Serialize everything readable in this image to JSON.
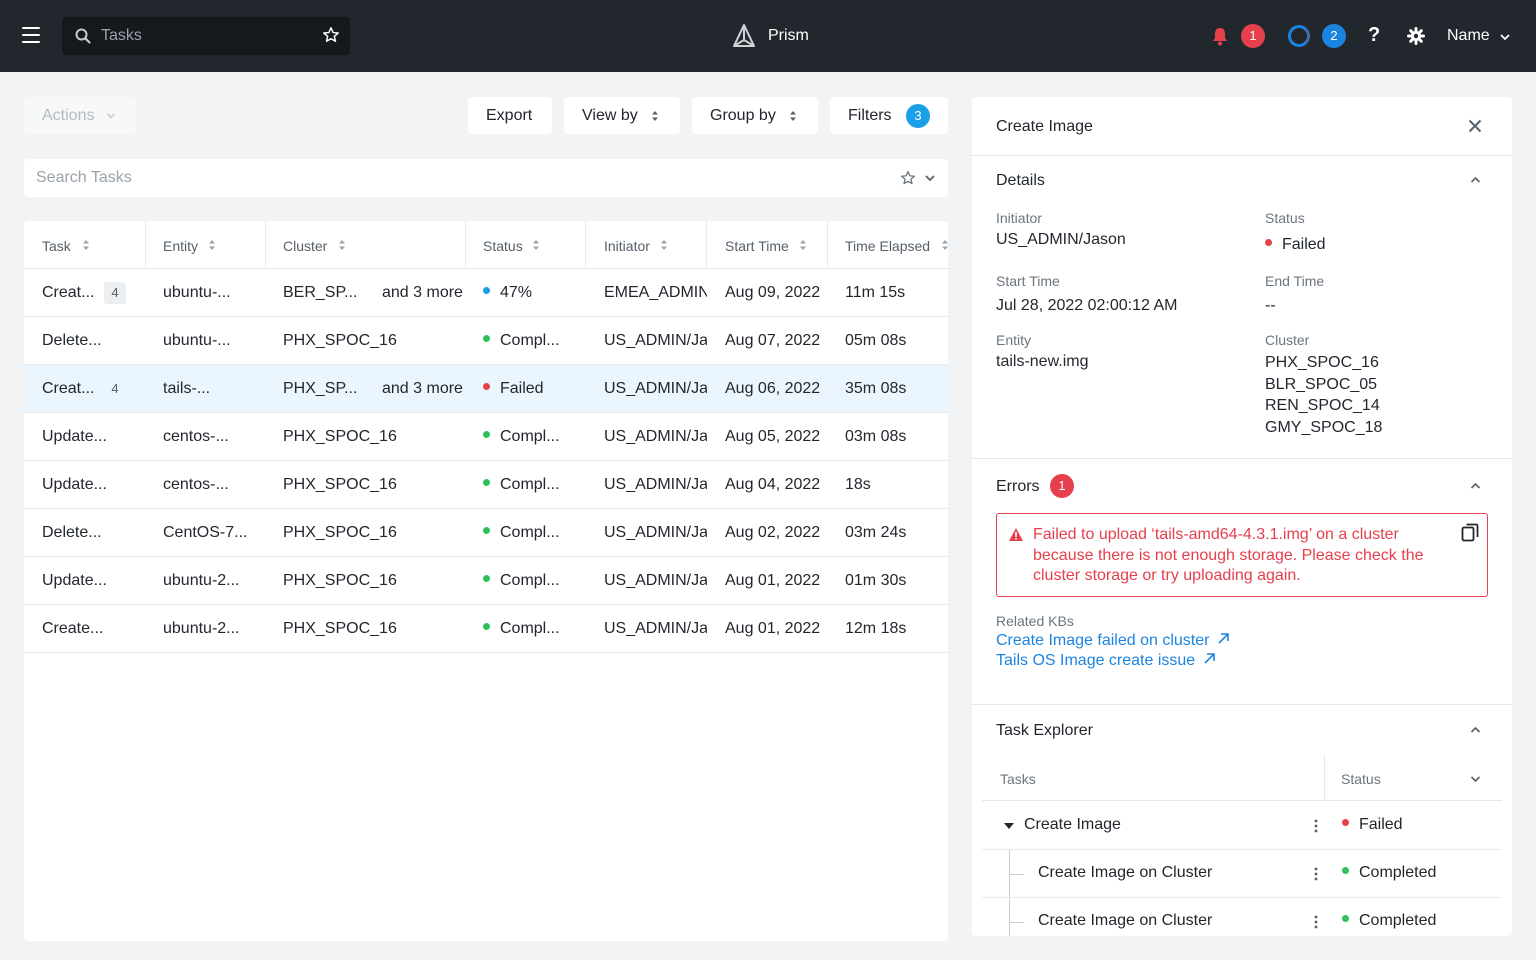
{
  "topbar": {
    "search_placeholder": "Tasks",
    "brand": "Prism",
    "alerts_count": "1",
    "tasks_count": "2",
    "help": "?",
    "user_name": "Name"
  },
  "toolbar": {
    "actions": "Actions",
    "export": "Export",
    "view_by": "View by",
    "group_by": "Group by",
    "filters": "Filters",
    "filters_count": "3",
    "search_placeholder": "Search Tasks"
  },
  "table": {
    "columns": [
      "Task",
      "Entity",
      "Cluster",
      "Status",
      "Initiator",
      "Start Time",
      "Time Elapsed"
    ],
    "rows": [
      {
        "task": "Creat...",
        "count": "4",
        "entity": "ubuntu-...",
        "cluster": "BER_SP...",
        "more": "and 3 more",
        "status": "47%",
        "status_type": "running",
        "initiator": "EMEA_ADMIN",
        "start": "Aug 09, 2022",
        "elapsed": "11m 15s"
      },
      {
        "task": "Delete...",
        "count": "",
        "entity": "ubuntu-...",
        "cluster": "PHX_SPOC_16",
        "more": "",
        "status": "Compl...",
        "status_type": "ok",
        "initiator": "US_ADMIN/Ja",
        "start": "Aug 07, 2022",
        "elapsed": "05m 08s"
      },
      {
        "task": "Creat...",
        "count": "4",
        "entity": "tails-...",
        "cluster": "PHX_SP...",
        "more": "and 3 more",
        "status": "Failed",
        "status_type": "failed",
        "initiator": "US_ADMIN/Ja",
        "start": "Aug 06, 2022",
        "elapsed": "35m 08s"
      },
      {
        "task": "Update...",
        "count": "",
        "entity": "centos-...",
        "cluster": "PHX_SPOC_16",
        "more": "",
        "status": "Compl...",
        "status_type": "ok",
        "initiator": "US_ADMIN/Ja",
        "start": "Aug 05, 2022",
        "elapsed": "03m 08s"
      },
      {
        "task": "Update...",
        "count": "",
        "entity": "centos-...",
        "cluster": "PHX_SPOC_16",
        "more": "",
        "status": "Compl...",
        "status_type": "ok",
        "initiator": "US_ADMIN/Ja",
        "start": "Aug 04, 2022",
        "elapsed": "18s"
      },
      {
        "task": "Delete...",
        "count": "",
        "entity": "CentOS-7...",
        "cluster": "PHX_SPOC_16",
        "more": "",
        "status": "Compl...",
        "status_type": "ok",
        "initiator": "US_ADMIN/Ja",
        "start": "Aug 02, 2022",
        "elapsed": "03m 24s"
      },
      {
        "task": "Update...",
        "count": "",
        "entity": "ubuntu-2...",
        "cluster": "PHX_SPOC_16",
        "more": "",
        "status": "Compl...",
        "status_type": "ok",
        "initiator": "US_ADMIN/Ja",
        "start": "Aug 01, 2022",
        "elapsed": "01m 30s"
      },
      {
        "task": "Create...",
        "count": "",
        "entity": "ubuntu-2...",
        "cluster": "PHX_SPOC_16",
        "more": "",
        "status": "Compl...",
        "status_type": "ok",
        "initiator": "US_ADMIN/Ja",
        "start": "Aug 01, 2022",
        "elapsed": "12m 18s"
      }
    ]
  },
  "panel": {
    "title": "Create Image",
    "details": {
      "title": "Details",
      "initiator_label": "Initiator",
      "initiator": "US_ADMIN/Jason",
      "status_label": "Status",
      "status": "Failed",
      "start_label": "Start Time",
      "start": "Jul 28, 2022 02:00:12 AM",
      "end_label": "End Time",
      "end": "--",
      "entity_label": "Entity",
      "entity": "tails-new.img",
      "cluster_label": "Cluster",
      "clusters": [
        "PHX_SPOC_16",
        "BLR_SPOC_05",
        "REN_SPOC_14",
        "GMY_SPOC_18"
      ]
    },
    "errors": {
      "title": "Errors",
      "count": "1",
      "message": "Failed to upload ‘tails-amd64-4.3.1.img’ on a cluster because there is not enough storage. Please check the cluster storage or try uploading again.",
      "kb_label": "Related KBs",
      "kbs": [
        "Create Image failed on cluster",
        "Tails OS Image create issue"
      ]
    },
    "explorer": {
      "title": "Task Explorer",
      "col_tasks": "Tasks",
      "col_status": "Status",
      "rows": [
        {
          "name": "Create Image",
          "status": "Failed"
        },
        {
          "name": "Create Image on Cluster",
          "status": "Completed"
        },
        {
          "name": "Create Image on Cluster",
          "status": "Completed"
        }
      ]
    }
  },
  "colors": {
    "topbar": "#22272e",
    "accent_blue": "#1b84e0",
    "error_red": "#e5404c",
    "success_green": "#2fc15e",
    "selected_row": "#eaf5fd"
  },
  "icons": [
    "menu-icon",
    "search-icon",
    "star-icon",
    "prism-logo-icon",
    "bell-icon",
    "spinner-icon",
    "help-icon",
    "gear-icon",
    "chevron-down-icon",
    "sort-icon",
    "close-icon",
    "chevron-up-icon",
    "warning-icon",
    "copy-icon",
    "external-link-icon",
    "kebab-icon",
    "caret-down-icon"
  ]
}
